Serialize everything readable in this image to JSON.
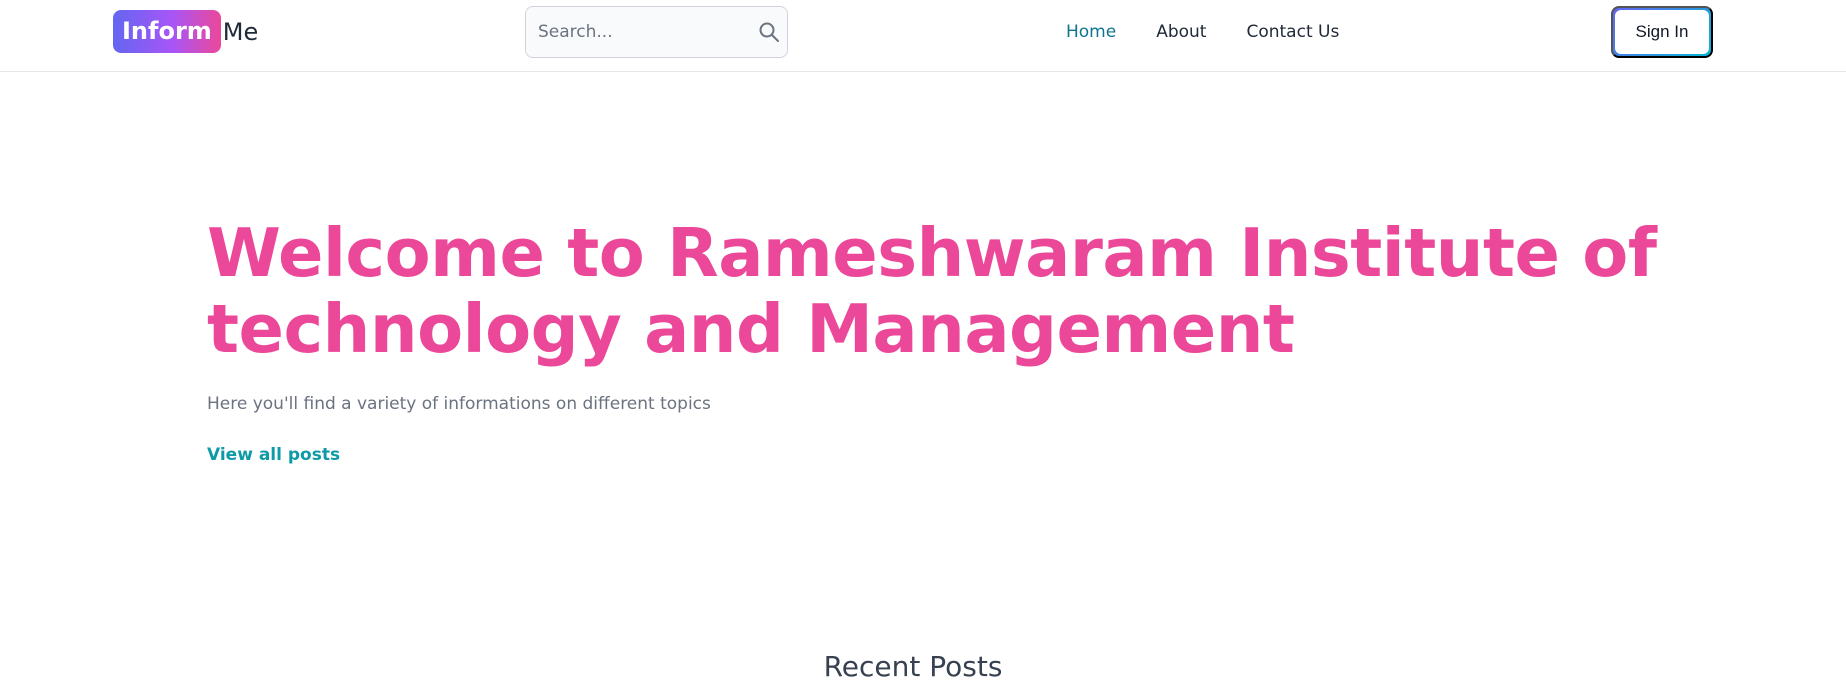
{
  "header": {
    "logo_badge": "Inform",
    "logo_rest": "Me",
    "search_placeholder": "Search...",
    "nav": [
      {
        "label": "Home",
        "active": true
      },
      {
        "label": "About",
        "active": false
      },
      {
        "label": "Contact Us",
        "active": false
      }
    ],
    "signin_label": "Sign In"
  },
  "hero": {
    "title": "Welcome to Rameshwaram Institute of technology and Management",
    "subtitle": "Here you'll find a variety of informations on different topics",
    "link_label": "View all posts"
  },
  "recent": {
    "title": "Recent Posts"
  },
  "colors": {
    "accent_pink": "#ec4899",
    "accent_teal": "#0e9aa7",
    "nav_active": "#0e7490"
  },
  "icons": {
    "search": "search-icon"
  }
}
